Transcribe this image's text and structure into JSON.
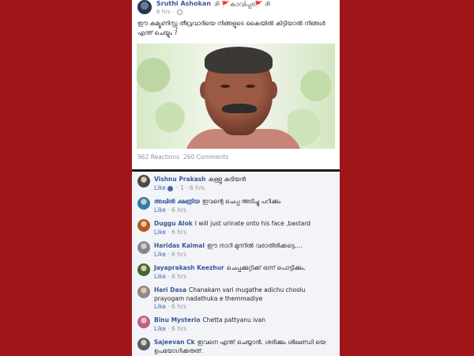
{
  "post": {
    "author": "Sruthi Ashokan",
    "author_flair": "ॐ 🚩കാവിപ്പട🚩 ॐ",
    "time": "6 hrs · ",
    "text": "ഈ കമ്യൂണിസ്റ്റു തീവ്രവാദിയെ നിങ്ങളുടെ കൈയിൽ കിട്ടിയാൽ നിങ്ങൾ എന്ത് ചെയ്യും ?",
    "reactions": "962 Reactions",
    "comments_count": "260 Comments"
  },
  "comments": [
    {
      "name": "Vishnu Prakash",
      "text": "കള്ളു കുടിയൻ",
      "like": "Like",
      "meta": " · 1 · 6 hrs",
      "avatar_color": "#4a4a4a",
      "reaction": true
    },
    {
      "name": "അഖിൽ ക്ഷത്രിയ",
      "text": "ഇവന്റെ ചെപ്പ അടിച്ചു പറിക്കും",
      "like": "Like",
      "meta": " · 6 hrs",
      "avatar_color": "#2d7fb0",
      "reaction": false
    },
    {
      "name": "Duggu Alok",
      "text": "I will just urinate onto his face ,bastard",
      "like": "Like",
      "meta": " · 6 hrs",
      "avatar_color": "#b35a1f",
      "reaction": false
    },
    {
      "name": "Haridas Kaimal",
      "text": "ഈ നാറി മുന്നിൽ വരാതിരിക്കട്ടെ....",
      "like": "Like",
      "meta": " · 6 hrs",
      "avatar_color": "#7b8a99",
      "reaction": false
    },
    {
      "name": "Jayaprakash Keezhur",
      "text": "ചെപ്പക്കുറ്റിക്ക് ഒന്ന് പൊട്ടിക്കും.",
      "like": "Like",
      "meta": " · 6 hrs",
      "avatar_color": "#3d6b2f",
      "reaction": false
    },
    {
      "name": "Hari Dasa",
      "text": "Chanakam vari mugathe adichu choolu prayogam nadathuka e themmadiye",
      "like": "Like",
      "meta": " · 6 hrs",
      "avatar_color": "#8a8a8a",
      "reaction": false
    },
    {
      "name": "Binu Mysterio",
      "text": "Chetta pattyanu ivan",
      "like": "Like",
      "meta": " · 6 hrs",
      "avatar_color": "#c25b8e",
      "reaction": false
    },
    {
      "name": "Sajeevan Ck",
      "text": "ഇവനെ എന്ത് ചെയ്യാൻ. ശരിക്കും ശിഖണ്ഡി യെ ഉപയോഗിക്കരുത്.",
      "like": "",
      "meta": "",
      "avatar_color": "#55606e",
      "reaction": false
    }
  ],
  "colors": {
    "background": "#a0151a",
    "link": "#385898",
    "meta": "#90949c"
  }
}
